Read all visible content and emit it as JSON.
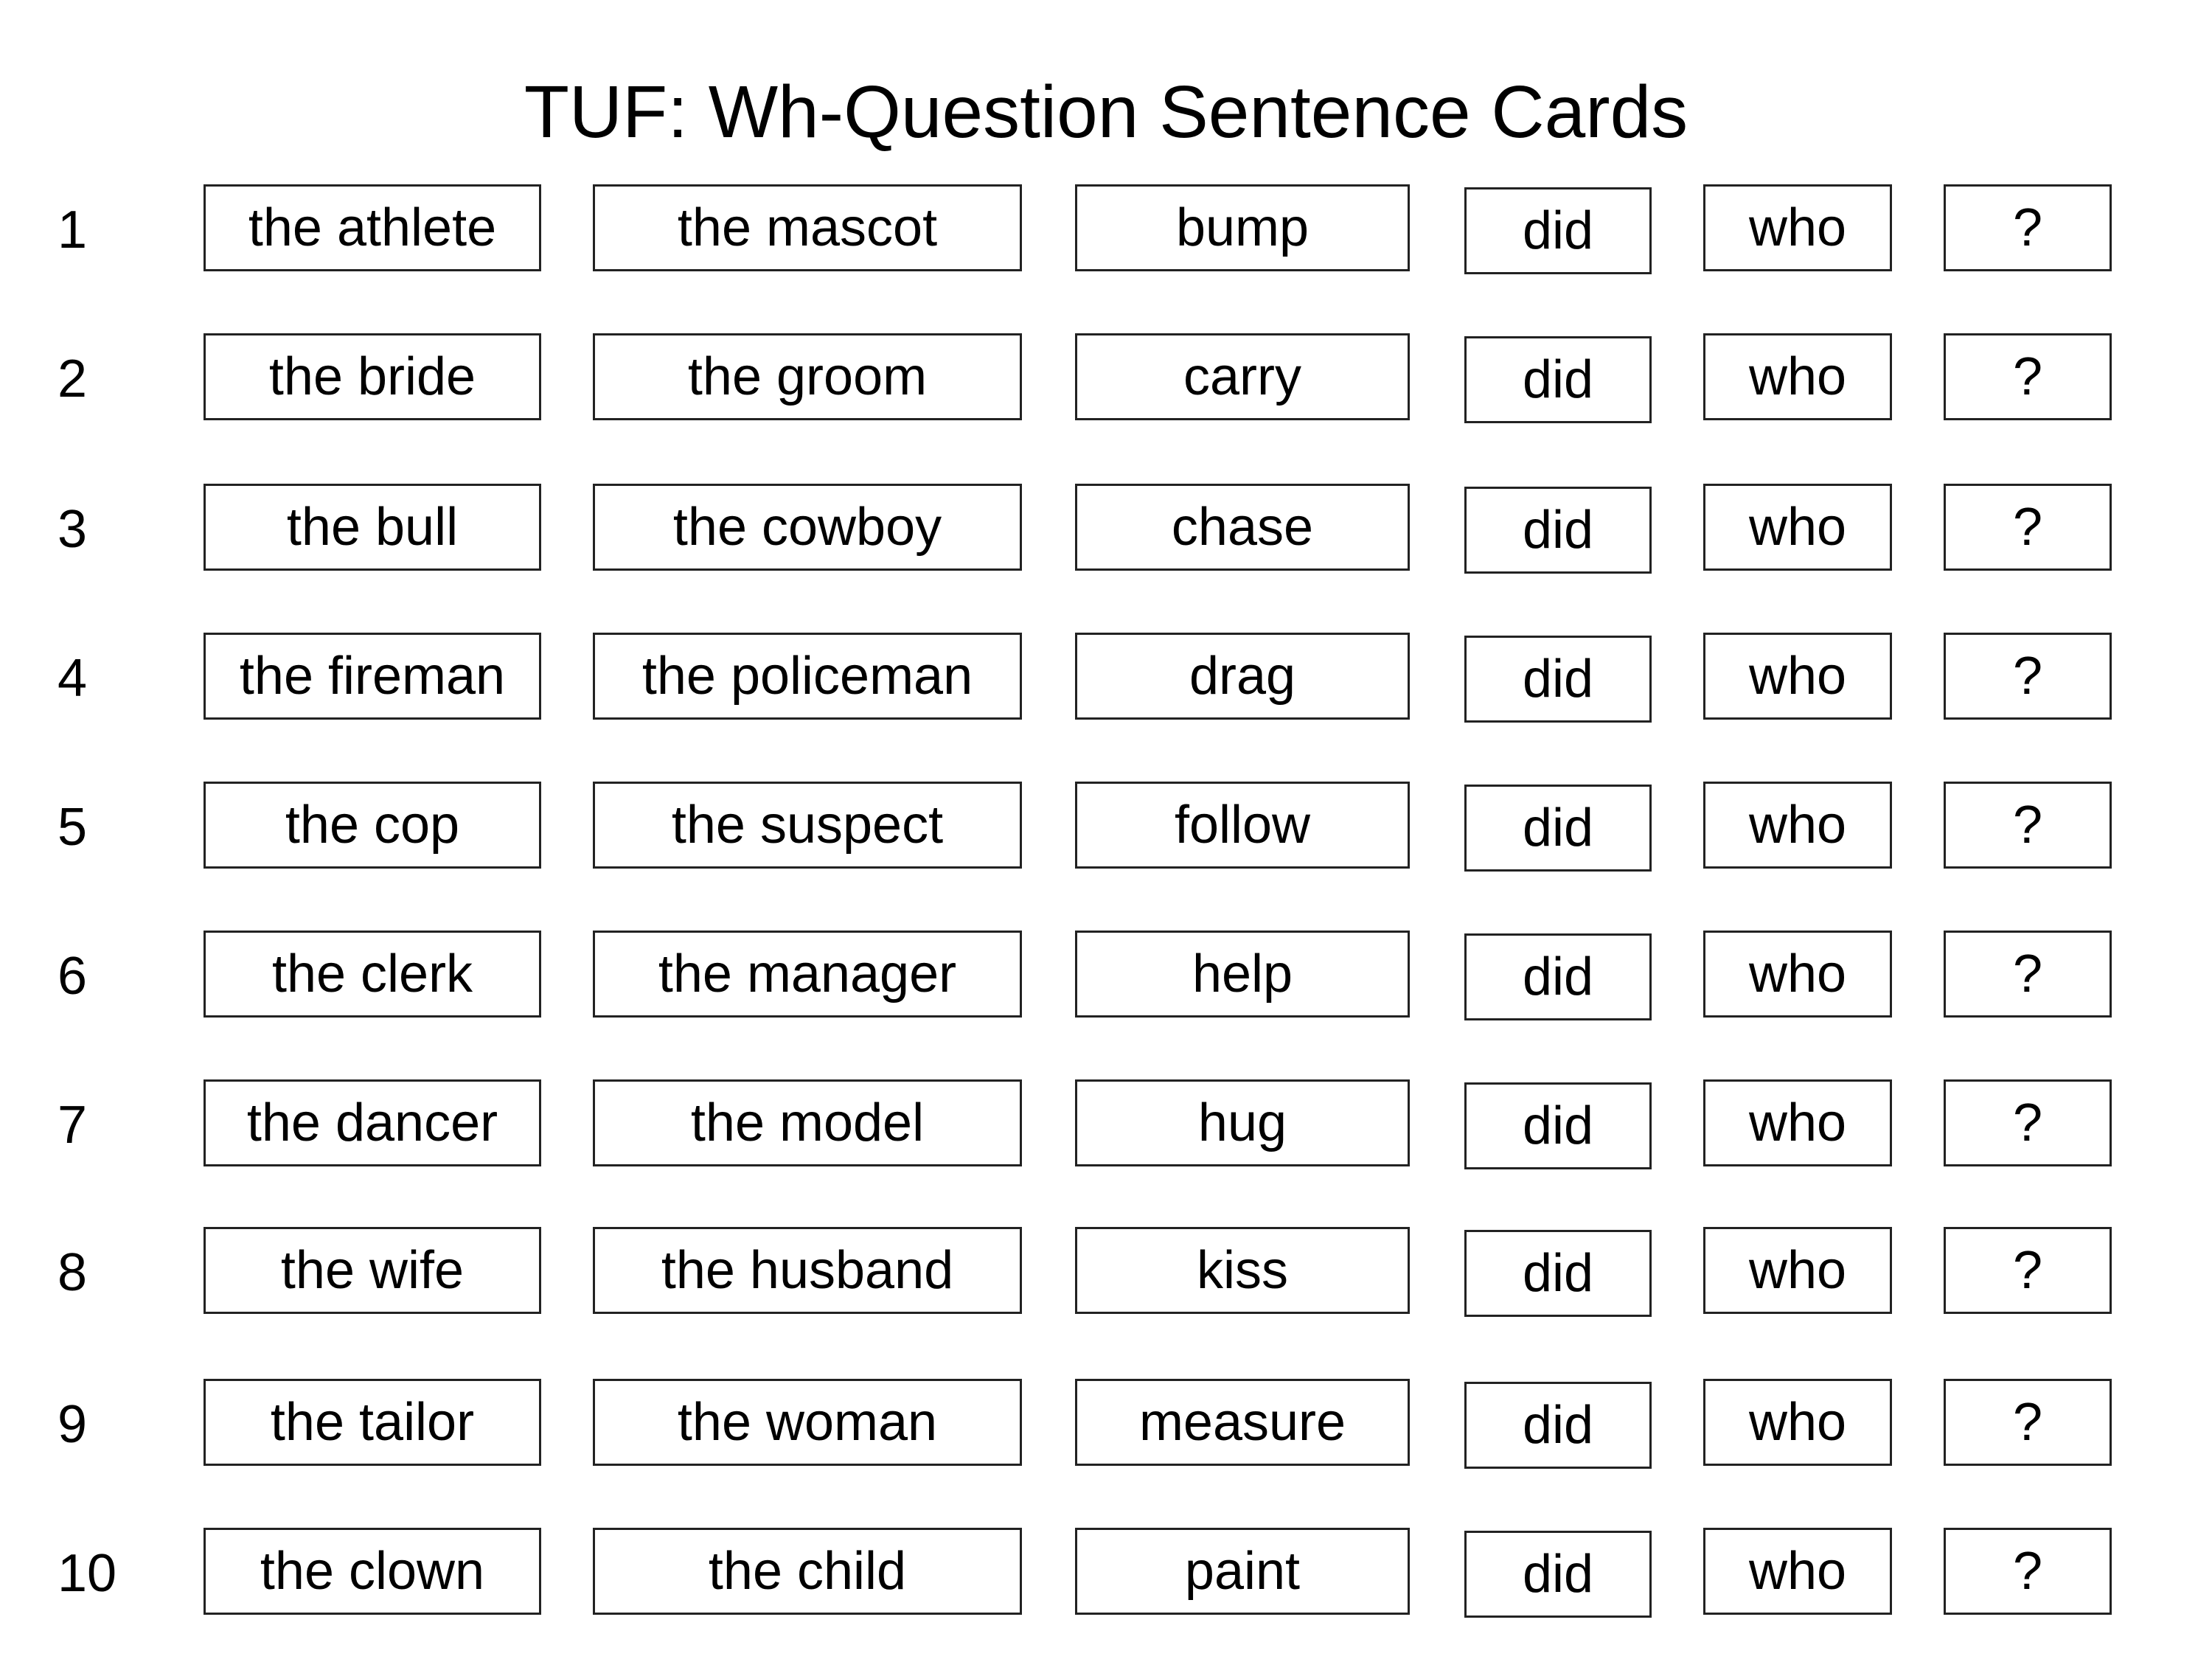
{
  "title": "TUF: Wh-Question Sentence Cards",
  "rows": [
    {
      "num": "1",
      "subject": "the athlete",
      "object": "the mascot",
      "verb": "bump",
      "aux": "did",
      "wh": "who",
      "mark": "?"
    },
    {
      "num": "2",
      "subject": "the bride",
      "object": "the groom",
      "verb": "carry",
      "aux": "did",
      "wh": "who",
      "mark": "?"
    },
    {
      "num": "3",
      "subject": "the bull",
      "object": "the cowboy",
      "verb": "chase",
      "aux": "did",
      "wh": "who",
      "mark": "?"
    },
    {
      "num": "4",
      "subject": "the fireman",
      "object": "the policeman",
      "verb": "drag",
      "aux": "did",
      "wh": "who",
      "mark": "?"
    },
    {
      "num": "5",
      "subject": "the cop",
      "object": "the suspect",
      "verb": "follow",
      "aux": "did",
      "wh": "who",
      "mark": "?"
    },
    {
      "num": "6",
      "subject": "the clerk",
      "object": "the manager",
      "verb": "help",
      "aux": "did",
      "wh": "who",
      "mark": "?"
    },
    {
      "num": "7",
      "subject": "the dancer",
      "object": "the model",
      "verb": "hug",
      "aux": "did",
      "wh": "who",
      "mark": "?"
    },
    {
      "num": "8",
      "subject": "the wife",
      "object": "the husband",
      "verb": "kiss",
      "aux": "did",
      "wh": "who",
      "mark": "?"
    },
    {
      "num": "9",
      "subject": "the tailor",
      "object": "the woman",
      "verb": "measure",
      "aux": "did",
      "wh": "who",
      "mark": "?"
    },
    {
      "num": "10",
      "subject": "the clown",
      "object": "the child",
      "verb": "paint",
      "aux": "did",
      "wh": "who",
      "mark": "?"
    }
  ]
}
